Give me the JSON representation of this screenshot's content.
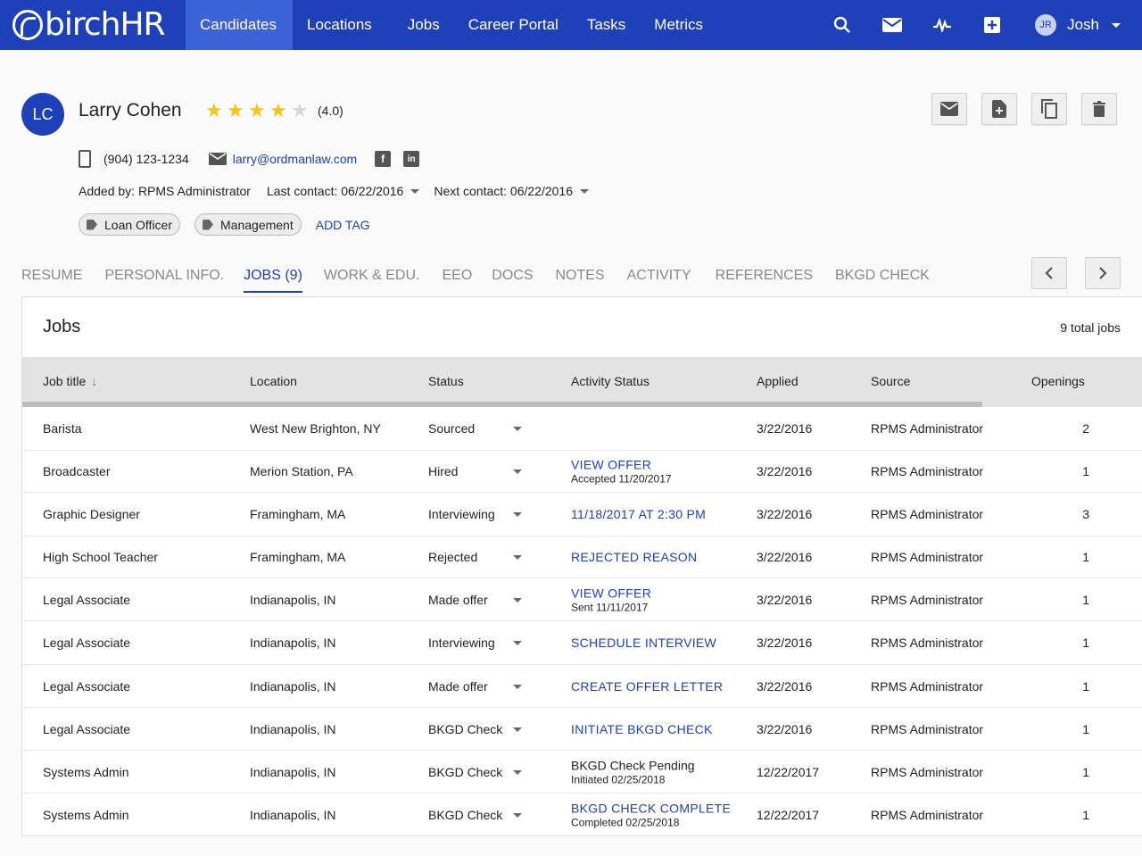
{
  "nav": {
    "logo": "birchHR",
    "tabs": [
      "Candidates",
      "Locations",
      "Jobs",
      "Career Portal",
      "Tasks",
      "Metrics"
    ],
    "user_initials": "JR",
    "user_name": "Josh"
  },
  "candidate": {
    "initials": "LC",
    "name": "Larry Cohen",
    "rating": 4,
    "rating_label": "(4.0)",
    "phone": "(904) 123-1234",
    "email": "larry@ordmanlaw.com",
    "added_by": "Added by: RPMS Administrator",
    "last_contact": "Last contact: 06/22/2016",
    "next_contact": "Next contact: 06/22/2016",
    "tags": [
      "Loan Officer",
      "Management"
    ],
    "add_tag": "ADD TAG"
  },
  "tabs": [
    "RESUME",
    "PERSONAL INFO.",
    "JOBS (9)",
    "WORK & EDU.",
    "EEO",
    "DOCS",
    "NOTES",
    "ACTIVITY",
    "REFERENCES",
    "BKGD CHECK"
  ],
  "jobs": {
    "title": "Jobs",
    "count": "9 total jobs",
    "columns": [
      "Job title",
      "Location",
      "Status",
      "Activity Status",
      "Applied",
      "Source",
      "Openings"
    ],
    "rows": [
      {
        "title": "Barista",
        "location": "West New Brighton, NY",
        "status": "Sourced",
        "activity": "",
        "activity_sub": "",
        "activity_link": true,
        "applied": "3/22/2016",
        "source": "RPMS Administrator",
        "openings": "2"
      },
      {
        "title": "Broadcaster",
        "location": "Merion Station, PA",
        "status": "Hired",
        "activity": "VIEW OFFER",
        "activity_sub": "Accepted 11/20/2017",
        "activity_link": true,
        "applied": "3/22/2016",
        "source": "RPMS Administrator",
        "openings": "1"
      },
      {
        "title": "Graphic Designer",
        "location": "Framingham, MA",
        "status": "Interviewing",
        "activity": "11/18/2017 AT 2:30 PM",
        "activity_sub": "",
        "activity_link": true,
        "applied": "3/22/2016",
        "source": "RPMS Administrator",
        "openings": "3"
      },
      {
        "title": "High School Teacher",
        "location": "Framingham, MA",
        "status": "Rejected",
        "activity": "REJECTED REASON",
        "activity_sub": "",
        "activity_link": true,
        "applied": "3/22/2016",
        "source": "RPMS Administrator",
        "openings": "1"
      },
      {
        "title": "Legal Associate",
        "location": "Indianapolis, IN",
        "status": "Made offer",
        "activity": "VIEW OFFER",
        "activity_sub": "Sent 11/11/2017",
        "activity_link": true,
        "applied": "3/22/2016",
        "source": "RPMS Administrator",
        "openings": "1"
      },
      {
        "title": "Legal Associate",
        "location": "Indianapolis, IN",
        "status": "Interviewing",
        "activity": "SCHEDULE INTERVIEW",
        "activity_sub": "",
        "activity_link": true,
        "applied": "3/22/2016",
        "source": "RPMS Administrator",
        "openings": "1"
      },
      {
        "title": "Legal Associate",
        "location": "Indianapolis, IN",
        "status": "Made offer",
        "activity": "CREATE OFFER LETTER",
        "activity_sub": "",
        "activity_link": true,
        "applied": "3/22/2016",
        "source": "RPMS Administrator",
        "openings": "1"
      },
      {
        "title": "Legal Associate",
        "location": "Indianapolis, IN",
        "status": "BKGD Check",
        "activity": "INITIATE BKGD CHECK",
        "activity_sub": "",
        "activity_link": true,
        "applied": "3/22/2016",
        "source": "RPMS Administrator",
        "openings": "1"
      },
      {
        "title": "Systems Admin",
        "location": "Indianapolis, IN",
        "status": "BKGD Check",
        "activity": "BKGD Check Pending",
        "activity_sub": "Initiated 02/25/2018",
        "activity_link": false,
        "applied": "12/22/2017",
        "source": "RPMS Administrator",
        "openings": "1"
      },
      {
        "title": "Systems Admin",
        "location": "Indianapolis, IN",
        "status": "BKGD Check",
        "activity": "BKGD CHECK COMPLETE",
        "activity_sub": "Completed 02/25/2018",
        "activity_link": true,
        "applied": "12/22/2017",
        "source": "RPMS Administrator",
        "openings": "1"
      }
    ]
  },
  "colors": {
    "brand": "#1e40b8",
    "active_tab": "#3b63d6",
    "star": "#f5c518"
  },
  "icons": [
    "search-icon",
    "mail-icon",
    "activity-icon",
    "plus-icon",
    "email-action-icon",
    "add-document-icon",
    "copy-icon",
    "delete-icon",
    "chevron-left-icon",
    "chevron-right-icon",
    "phone-icon",
    "facebook-icon",
    "linkedin-icon",
    "tag-icon"
  ]
}
